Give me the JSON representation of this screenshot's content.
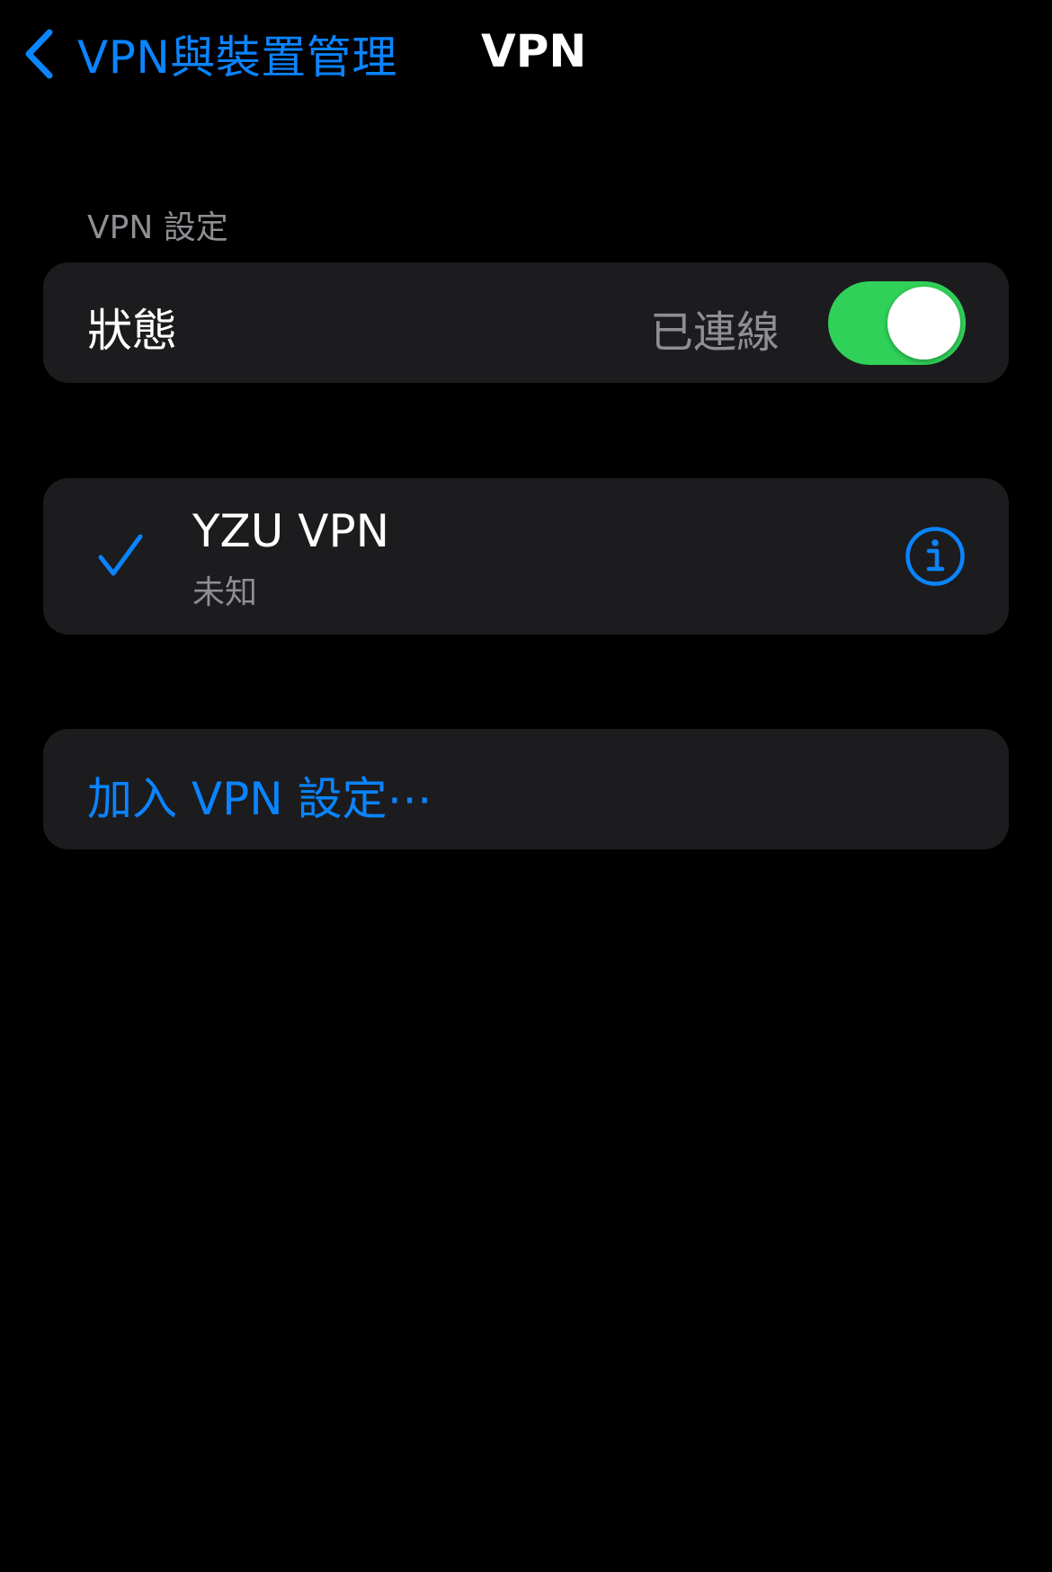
{
  "colors": {
    "background": "#000000",
    "card": "#1C1C1E",
    "accent": "#0A84FF",
    "toggle_on": "#30D158",
    "secondary_text": "#8E8E93"
  },
  "nav": {
    "back_label": "VPN與裝置管理",
    "back_icon": "chevron-left-icon",
    "title": "VPN"
  },
  "vpn_settings": {
    "section_header": "VPN 設定",
    "status": {
      "label": "狀態",
      "value": "已連線",
      "toggle_on": true
    }
  },
  "configurations": [
    {
      "name": "YZU VPN",
      "subtitle": "未知",
      "selected": true,
      "selected_icon": "checkmark-icon",
      "info_icon": "info-circle-icon"
    }
  ],
  "add_configuration": {
    "label": "加入 VPN 設定⋯"
  }
}
